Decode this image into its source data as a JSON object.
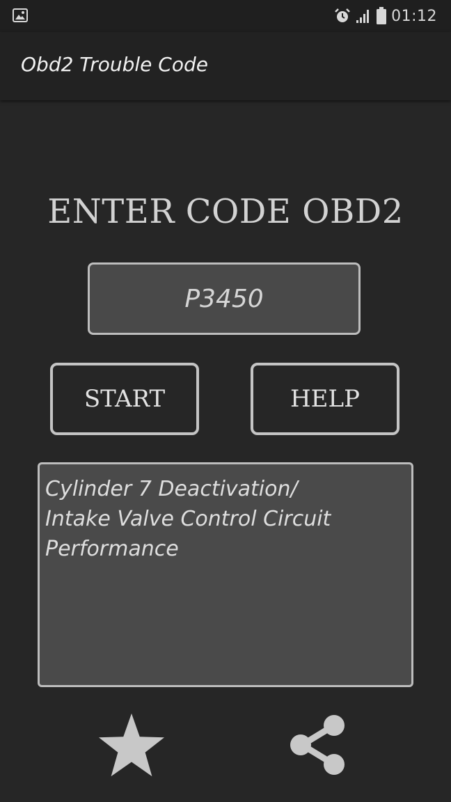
{
  "status_bar": {
    "time": "01:12",
    "icons": [
      "gallery-icon",
      "alarm-icon",
      "signal-icon",
      "battery-icon"
    ]
  },
  "app_bar": {
    "title": "Obd2 Trouble Code"
  },
  "main": {
    "heading": "ENTER CODE OBD2",
    "code_input": {
      "value": "P3450"
    },
    "start_label": "START",
    "help_label": "HELP",
    "result_text": "Cylinder 7 Deactivation/\nIntake Valve Control Circuit\nPerformance"
  },
  "bottom": {
    "icons": [
      "star-icon",
      "share-icon"
    ]
  },
  "colors": {
    "background": "#262626",
    "panel": "#4a4a4a",
    "border": "#bdbdbd",
    "text": "#e6e6e6"
  }
}
